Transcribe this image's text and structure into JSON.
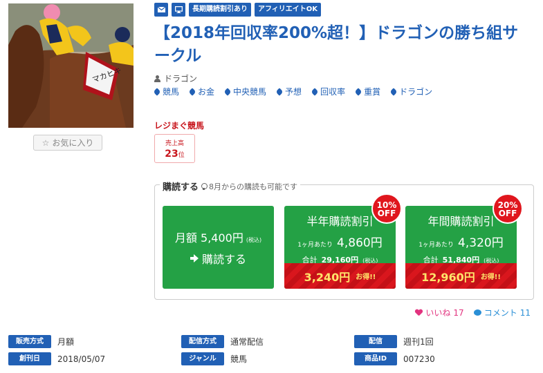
{
  "thumbnail": {
    "alt": "horse racing photo",
    "saddle_text": "マカヒキ"
  },
  "favorite": {
    "label": "お気に入り",
    "icon": "star-outline-icon"
  },
  "badges": [
    {
      "icon": "mail-icon"
    },
    {
      "icon": "monitor-icon"
    },
    {
      "label": "長期購読割引あり"
    },
    {
      "label": "アフィリエイトOK"
    }
  ],
  "title": "【2018年回収率200%超！】ドラゴンの勝ち組サークル",
  "author": "ドラゴン",
  "tags": [
    "競馬",
    "お金",
    "中央競馬",
    "予想",
    "回収率",
    "重賞",
    "ドラゴン"
  ],
  "ranking": {
    "site": "レジまぐ競馬",
    "label": "売上高",
    "value": "23",
    "unit": "位"
  },
  "subscribe": {
    "heading": "購読する",
    "note": "8月からの購読も可能です",
    "monthly": {
      "label": "月額 5,400円",
      "tax": "(税込)",
      "action": "購読する"
    },
    "half_year": {
      "title": "半年購読割引",
      "per_month_label": "1ヶ月あたり",
      "per_month": "4,860円",
      "total_label": "合計",
      "total": "29,160円",
      "tax": "(税込)",
      "saving": "3,240円",
      "saving_label": "お得!!",
      "off_pct": "10%",
      "off_label": "OFF"
    },
    "year": {
      "title": "年間購読割引",
      "per_month_label": "1ヶ月あたり",
      "per_month": "4,320円",
      "total_label": "合計",
      "total": "51,840円",
      "tax": "(税込)",
      "saving": "12,960円",
      "saving_label": "お得!!",
      "off_pct": "20%",
      "off_label": "OFF"
    }
  },
  "reactions": {
    "like_label": "いいね",
    "like_count": "17",
    "comment_label": "コメント",
    "comment_count": "11"
  },
  "info": [
    {
      "key": "販売方式",
      "value": "月額"
    },
    {
      "key": "配信方式",
      "value": "通常配信"
    },
    {
      "key": "配信",
      "value": "週刊1回"
    },
    {
      "key": "創刊日",
      "value": "2018/05/07"
    },
    {
      "key": "ジャンル",
      "value": "競馬"
    },
    {
      "key": "商品ID",
      "value": "007230"
    }
  ],
  "colors": {
    "brand_blue": "#2160b5",
    "green": "#24a145",
    "red": "#e0161d",
    "pink": "#e2337f"
  }
}
